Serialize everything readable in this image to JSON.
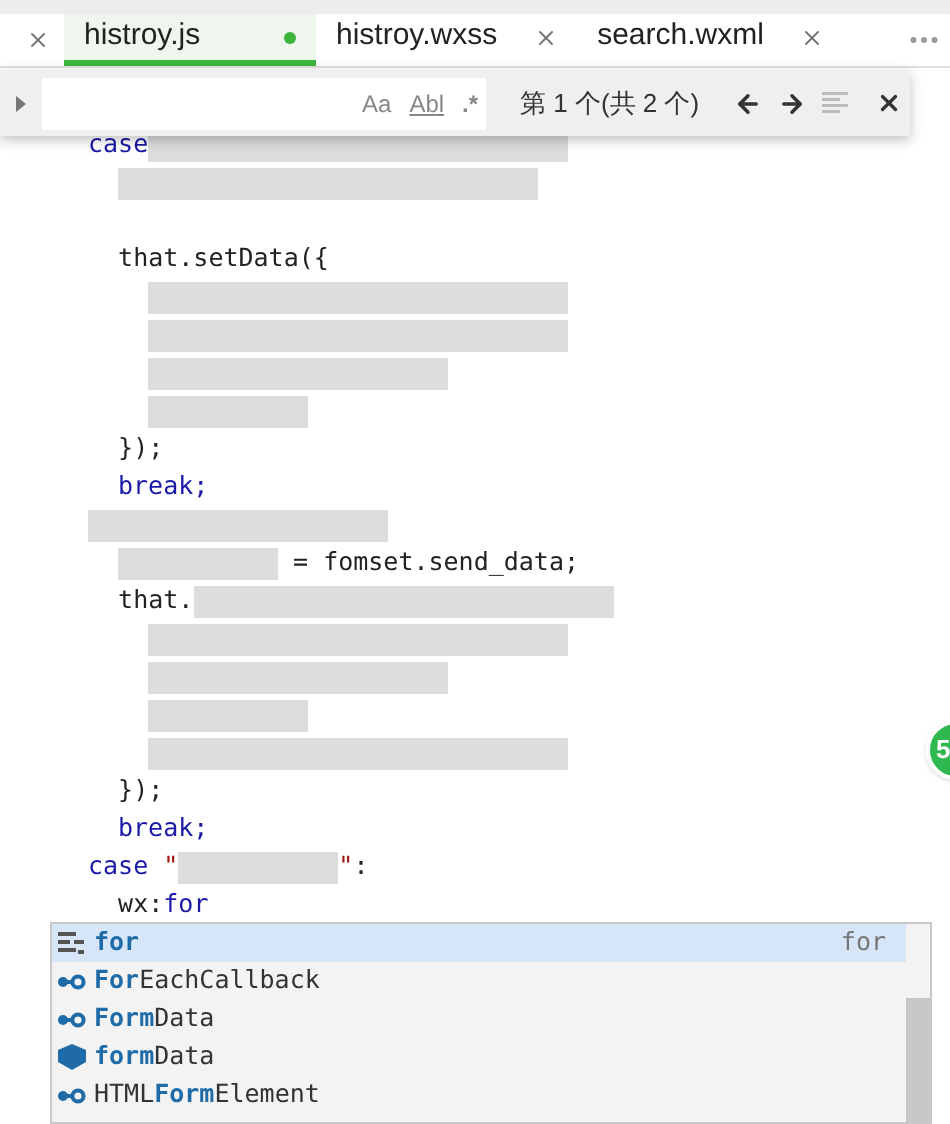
{
  "tabs": [
    {
      "label": "histroy.js",
      "selected": true,
      "modified": true
    },
    {
      "label": "histroy.wxss",
      "selected": false,
      "modified": false
    },
    {
      "label": "search.wxml",
      "selected": false,
      "modified": false
    }
  ],
  "find": {
    "match_case": "Aa",
    "whole_word": "Abl",
    "regex": ".*",
    "result": "第 1 个(共 2 个)"
  },
  "code_lines": [
    {
      "kind": "code",
      "parts": [
        {
          "kind": "keyword",
          "text": "case"
        },
        {
          "kind": "blur"
        }
      ]
    },
    {
      "kind": "code",
      "parts": [
        {
          "kind": "indent"
        },
        {
          "kind": "blur"
        }
      ]
    },
    {
      "kind": "blank"
    },
    {
      "kind": "code",
      "parts": [
        {
          "kind": "plain",
          "text": "  that.setData({"
        }
      ]
    },
    {
      "kind": "code",
      "parts": [
        {
          "kind": "indent2"
        },
        {
          "kind": "blur"
        }
      ]
    },
    {
      "kind": "code",
      "parts": [
        {
          "kind": "indent2"
        },
        {
          "kind": "blur"
        }
      ]
    },
    {
      "kind": "code",
      "parts": [
        {
          "kind": "indent2"
        },
        {
          "kind": "blur"
        }
      ]
    },
    {
      "kind": "code",
      "parts": [
        {
          "kind": "indent2"
        },
        {
          "kind": "blur"
        }
      ]
    },
    {
      "kind": "code",
      "parts": [
        {
          "kind": "plain",
          "text": "  });"
        }
      ]
    },
    {
      "kind": "code",
      "parts": [
        {
          "kind": "indent"
        },
        {
          "kind": "keyword",
          "text": "break;"
        }
      ]
    },
    {
      "kind": "code",
      "parts": [
        {
          "kind": "blur"
        }
      ]
    },
    {
      "kind": "code",
      "parts": [
        {
          "kind": "indent"
        },
        {
          "kind": "blur"
        },
        {
          "kind": "plain",
          "text": " = fomset.send_data;"
        }
      ]
    },
    {
      "kind": "code",
      "parts": [
        {
          "kind": "plain",
          "text": "  that."
        },
        {
          "kind": "blur"
        }
      ]
    },
    {
      "kind": "code",
      "parts": [
        {
          "kind": "indent2"
        },
        {
          "kind": "blur"
        }
      ]
    },
    {
      "kind": "code",
      "parts": [
        {
          "kind": "indent2"
        },
        {
          "kind": "blur"
        }
      ]
    },
    {
      "kind": "code",
      "parts": [
        {
          "kind": "indent2"
        },
        {
          "kind": "blur"
        }
      ]
    },
    {
      "kind": "code",
      "parts": [
        {
          "kind": "indent2"
        },
        {
          "kind": "blur"
        }
      ]
    },
    {
      "kind": "code",
      "parts": [
        {
          "kind": "plain",
          "text": "  });"
        }
      ]
    },
    {
      "kind": "code",
      "parts": [
        {
          "kind": "indent"
        },
        {
          "kind": "keyword",
          "text": "break;"
        }
      ]
    },
    {
      "kind": "code",
      "parts": [
        {
          "kind": "keyword",
          "text": "case"
        },
        {
          "kind": "string",
          "text": " \""
        },
        {
          "kind": "blur"
        },
        {
          "kind": "string",
          "text": "\""
        },
        {
          "kind": "plain",
          "text": ":"
        }
      ]
    },
    {
      "kind": "code",
      "parts": [
        {
          "kind": "plain",
          "text": "  wx:"
        },
        {
          "kind": "keyword",
          "text": "for"
        }
      ]
    }
  ],
  "badge": "5",
  "suggestions": [
    {
      "kind": "snippet",
      "match": "for",
      "detail": "for",
      "selected": true
    },
    {
      "kind": "interface",
      "match": "For",
      "rest": "EachCallback",
      "selected": false
    },
    {
      "kind": "interface",
      "match": "Form",
      "rest": "Data",
      "selected": false
    },
    {
      "kind": "module",
      "match": "form",
      "rest": "Data",
      "selected": false
    },
    {
      "kind": "interface",
      "prefix": "HTML",
      "match": "Form",
      "rest": "Element",
      "selected": false
    }
  ]
}
